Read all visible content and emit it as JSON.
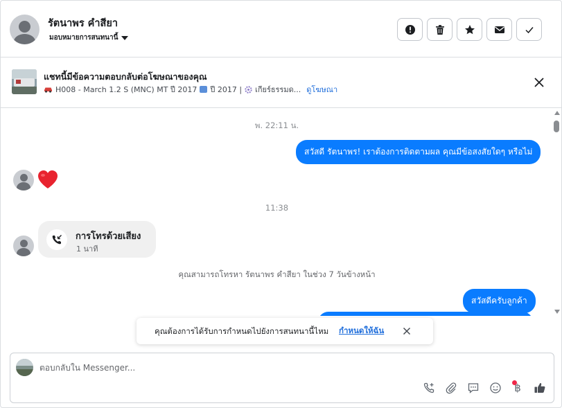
{
  "header": {
    "contact_name": "รัตนาพร คำสียา",
    "assign_label": "มอบหมายการสนทนานี้",
    "buttons": [
      {
        "icon": "alert-icon",
        "name": "spam-button"
      },
      {
        "icon": "trash-icon",
        "name": "delete-button"
      },
      {
        "icon": "star-icon",
        "name": "star-button"
      },
      {
        "icon": "mail-icon",
        "name": "unread-button"
      },
      {
        "icon": "check-icon",
        "name": "done-button"
      }
    ]
  },
  "ad": {
    "title": "แชทนี้มีข้อความตอบกลับต่อโฆษณาของคุณ",
    "model": "H008 - March 1.2 S (MNC) MT ปี 2017",
    "year": "ปี 2017 |",
    "gear": "เกียร์ธรรมด...",
    "link": "ดูโฆษณา"
  },
  "chat": {
    "timestamp_1": "พ. 22:11 น.",
    "message_out_1": "สวัสดี รัตนาพร! เราต้องการติดตามผล คุณมีข้อสงสัยใดๆ หรือไม่",
    "reaction_in": "❤️",
    "timestamp_2": "11:38",
    "call_title": "การโทรด้วยเสียง",
    "call_duration": "1 นาที",
    "call_info": "คุณสามารถโทรหา รัตนาพร คำสียา ในช่วง 7 วันข้างหน้า",
    "message_out_2": "สวัสดีครับลูกค้า"
  },
  "toast": {
    "text": "คุณต้องการได้รับการกำหนดไปยังการสนทนานี้ไหม",
    "link": "กำหนดให้ฉัน"
  },
  "composer": {
    "placeholder": "ตอบกลับใน Messenger...",
    "baht_symbol": "฿"
  },
  "colors": {
    "accent": "#0a7cff",
    "link": "#216fdb",
    "notification": "#f02849"
  }
}
